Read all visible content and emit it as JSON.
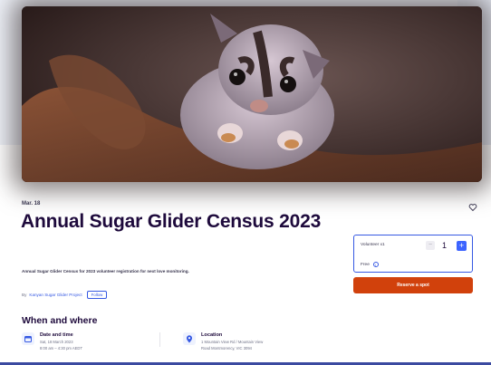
{
  "event": {
    "date_short": "Mar. 18",
    "title": "Annual Sugar Glider Census 2023",
    "summary": "Annual Sugar Glider Census for 2023 volunteer registration for next love monitoring.",
    "organizer_prefix": "By",
    "organizer_name": "Kanyan Sugar Glider Project",
    "follow_label": "Follow"
  },
  "when_where": {
    "section_title": "When and where",
    "date_time": {
      "heading": "Date and time",
      "line1": "Sat, 18 March 2023",
      "line2": "8:00 am – 4:30 pm AEDT"
    },
    "location": {
      "heading": "Location",
      "line1": "1 Mountain View Rd / Mountain View",
      "line2": "Road Montmorency, VIC 3094"
    }
  },
  "ticket": {
    "name": "Volunteer x1",
    "quantity": "1",
    "minus": "−",
    "plus": "+",
    "price": "Free",
    "info_glyph": "i"
  },
  "reserve_button": "Reserve a spot",
  "colors": {
    "brand_orange": "#d1410c",
    "accent_blue": "#3659e3",
    "title_ink": "#1e0a3c"
  },
  "icons": [
    "heart-icon",
    "calendar-icon",
    "location-pin-icon",
    "info-icon"
  ]
}
